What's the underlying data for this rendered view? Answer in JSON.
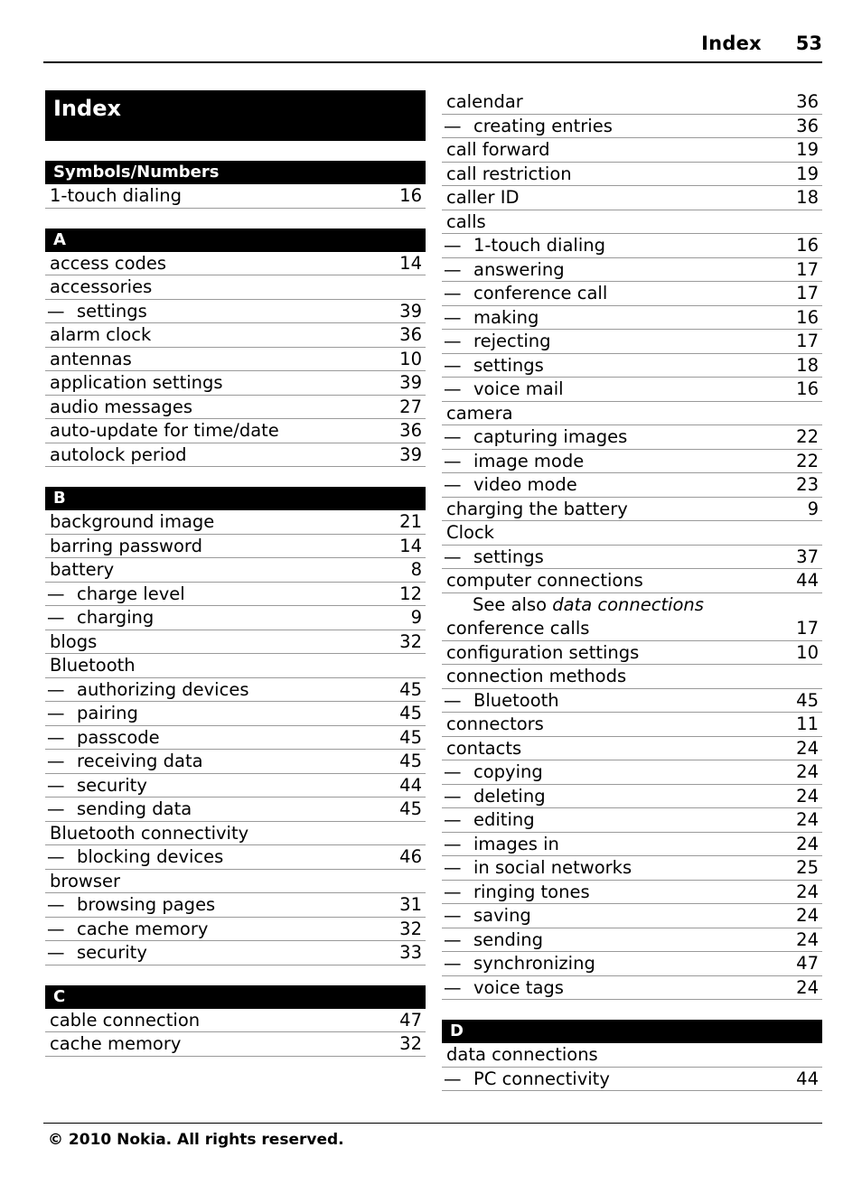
{
  "header": {
    "title": "Index",
    "page_number": "53"
  },
  "index_title": "Index",
  "footer": {
    "copyright": "© 2010 Nokia. All rights reserved."
  },
  "columns": [
    {
      "blocks": [
        {
          "type": "title",
          "label": "Index"
        },
        {
          "type": "section",
          "label": "Symbols/Numbers"
        },
        {
          "type": "entry",
          "label": "1-touch dialing",
          "page": "16"
        },
        {
          "type": "section",
          "label": "A"
        },
        {
          "type": "entry",
          "label": "access codes",
          "page": "14"
        },
        {
          "type": "entry",
          "label": "accessories",
          "page": ""
        },
        {
          "type": "entry",
          "sub": true,
          "label": "settings",
          "page": "39"
        },
        {
          "type": "entry",
          "label": "alarm clock",
          "page": "36"
        },
        {
          "type": "entry",
          "label": "antennas",
          "page": "10"
        },
        {
          "type": "entry",
          "label": "application settings",
          "page": "39"
        },
        {
          "type": "entry",
          "label": "audio messages",
          "page": "27"
        },
        {
          "type": "entry",
          "label": "auto-update for time/date",
          "page": "36"
        },
        {
          "type": "entry",
          "label": "autolock period",
          "page": "39"
        },
        {
          "type": "section",
          "label": "B"
        },
        {
          "type": "entry",
          "label": "background image",
          "page": "21"
        },
        {
          "type": "entry",
          "label": "barring password",
          "page": "14"
        },
        {
          "type": "entry",
          "label": "battery",
          "page": "8"
        },
        {
          "type": "entry",
          "sub": true,
          "label": "charge level",
          "page": "12"
        },
        {
          "type": "entry",
          "sub": true,
          "label": "charging",
          "page": "9"
        },
        {
          "type": "entry",
          "label": "blogs",
          "page": "32"
        },
        {
          "type": "entry",
          "label": "Bluetooth",
          "page": ""
        },
        {
          "type": "entry",
          "sub": true,
          "label": "authorizing devices",
          "page": "45"
        },
        {
          "type": "entry",
          "sub": true,
          "label": "pairing",
          "page": "45"
        },
        {
          "type": "entry",
          "sub": true,
          "label": "passcode",
          "page": "45"
        },
        {
          "type": "entry",
          "sub": true,
          "label": "receiving data",
          "page": "45"
        },
        {
          "type": "entry",
          "sub": true,
          "label": "security",
          "page": "44"
        },
        {
          "type": "entry",
          "sub": true,
          "label": "sending data",
          "page": "45"
        },
        {
          "type": "entry",
          "label": "Bluetooth connectivity",
          "page": ""
        },
        {
          "type": "entry",
          "sub": true,
          "label": "blocking devices",
          "page": "46"
        },
        {
          "type": "entry",
          "label": "browser",
          "page": ""
        },
        {
          "type": "entry",
          "sub": true,
          "label": "browsing pages",
          "page": "31"
        },
        {
          "type": "entry",
          "sub": true,
          "label": "cache memory",
          "page": "32"
        },
        {
          "type": "entry",
          "sub": true,
          "label": "security",
          "page": "33"
        },
        {
          "type": "section",
          "label": "C"
        },
        {
          "type": "entry",
          "label": "cable connection",
          "page": "47"
        },
        {
          "type": "entry",
          "label": "cache memory",
          "page": "32"
        }
      ]
    },
    {
      "blocks": [
        {
          "type": "entry",
          "label": "calendar",
          "page": "36"
        },
        {
          "type": "entry",
          "sub": true,
          "label": "creating entries",
          "page": "36"
        },
        {
          "type": "entry",
          "label": "call forward",
          "page": "19"
        },
        {
          "type": "entry",
          "label": "call restriction",
          "page": "19"
        },
        {
          "type": "entry",
          "label": "caller ID",
          "page": "18"
        },
        {
          "type": "entry",
          "label": "calls",
          "page": ""
        },
        {
          "type": "entry",
          "sub": true,
          "label": "1-touch dialing",
          "page": "16"
        },
        {
          "type": "entry",
          "sub": true,
          "label": "answering",
          "page": "17"
        },
        {
          "type": "entry",
          "sub": true,
          "label": "conference call",
          "page": "17"
        },
        {
          "type": "entry",
          "sub": true,
          "label": "making",
          "page": "16"
        },
        {
          "type": "entry",
          "sub": true,
          "label": "rejecting",
          "page": "17"
        },
        {
          "type": "entry",
          "sub": true,
          "label": "settings",
          "page": "18"
        },
        {
          "type": "entry",
          "sub": true,
          "label": "voice mail",
          "page": "16"
        },
        {
          "type": "entry",
          "label": "camera",
          "page": ""
        },
        {
          "type": "entry",
          "sub": true,
          "label": "capturing images",
          "page": "22"
        },
        {
          "type": "entry",
          "sub": true,
          "label": "image mode",
          "page": "22"
        },
        {
          "type": "entry",
          "sub": true,
          "label": "video mode",
          "page": "23"
        },
        {
          "type": "entry",
          "label": "charging the battery",
          "page": "9"
        },
        {
          "type": "entry",
          "label": "Clock",
          "page": ""
        },
        {
          "type": "entry",
          "sub": true,
          "label": "settings",
          "page": "37"
        },
        {
          "type": "entry",
          "label": "computer connections",
          "page": "44"
        },
        {
          "type": "see_also",
          "prefix": "See also",
          "target": "data connections"
        },
        {
          "type": "entry",
          "label": "conference calls",
          "page": "17"
        },
        {
          "type": "entry",
          "label": "configuration settings",
          "page": "10"
        },
        {
          "type": "entry",
          "label": "connection methods",
          "page": ""
        },
        {
          "type": "entry",
          "sub": true,
          "label": "Bluetooth",
          "page": "45"
        },
        {
          "type": "entry",
          "label": "connectors",
          "page": "11"
        },
        {
          "type": "entry",
          "label": "contacts",
          "page": "24"
        },
        {
          "type": "entry",
          "sub": true,
          "label": "copying",
          "page": "24"
        },
        {
          "type": "entry",
          "sub": true,
          "label": "deleting",
          "page": "24"
        },
        {
          "type": "entry",
          "sub": true,
          "label": "editing",
          "page": "24"
        },
        {
          "type": "entry",
          "sub": true,
          "label": "images in",
          "page": "24"
        },
        {
          "type": "entry",
          "sub": true,
          "label": "in social networks",
          "page": "25"
        },
        {
          "type": "entry",
          "sub": true,
          "label": "ringing tones",
          "page": "24"
        },
        {
          "type": "entry",
          "sub": true,
          "label": "saving",
          "page": "24"
        },
        {
          "type": "entry",
          "sub": true,
          "label": "sending",
          "page": "24"
        },
        {
          "type": "entry",
          "sub": true,
          "label": "synchronizing",
          "page": "47"
        },
        {
          "type": "entry",
          "sub": true,
          "label": "voice tags",
          "page": "24"
        },
        {
          "type": "section",
          "label": "D"
        },
        {
          "type": "entry",
          "label": "data connections",
          "page": ""
        },
        {
          "type": "entry",
          "sub": true,
          "label": "PC connectivity",
          "page": "44"
        }
      ]
    }
  ],
  "dash_glyph": "—"
}
